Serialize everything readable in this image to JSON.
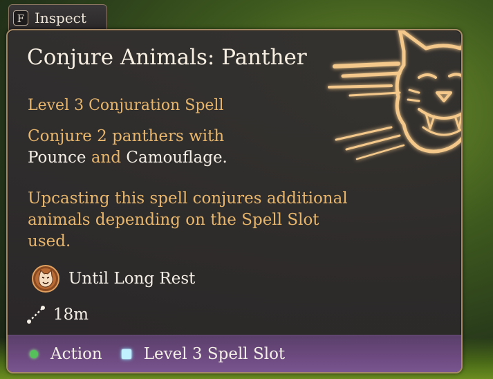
{
  "inspect": {
    "key": "F",
    "label": "Inspect"
  },
  "spell": {
    "title": "Conjure Animals: Panther",
    "subtitle": "Level 3 Conjuration Spell",
    "description": {
      "line1": "Conjure 2 panthers with",
      "pounce": "Pounce",
      "and": " and ",
      "camouflage": "Camouflage."
    },
    "upcast": "Upcasting this spell conjures additional animals depending on the Spell Slot used.",
    "duration": "Until Long Rest",
    "range": "18m",
    "cost": {
      "action": "Action",
      "slot": "Level 3 Spell Slot"
    }
  },
  "colors": {
    "accent": "#e7b66c",
    "highlight": "#f4efe6",
    "footer": "#6d4a80",
    "action_dot": "#56c05a",
    "slot_square": "#bff1ff"
  },
  "icons": {
    "spell_art": "panther-head-icon",
    "duration": "panther-duration-icon",
    "range": "range-icon",
    "action": "action-dot-icon",
    "slot": "spell-slot-icon"
  }
}
